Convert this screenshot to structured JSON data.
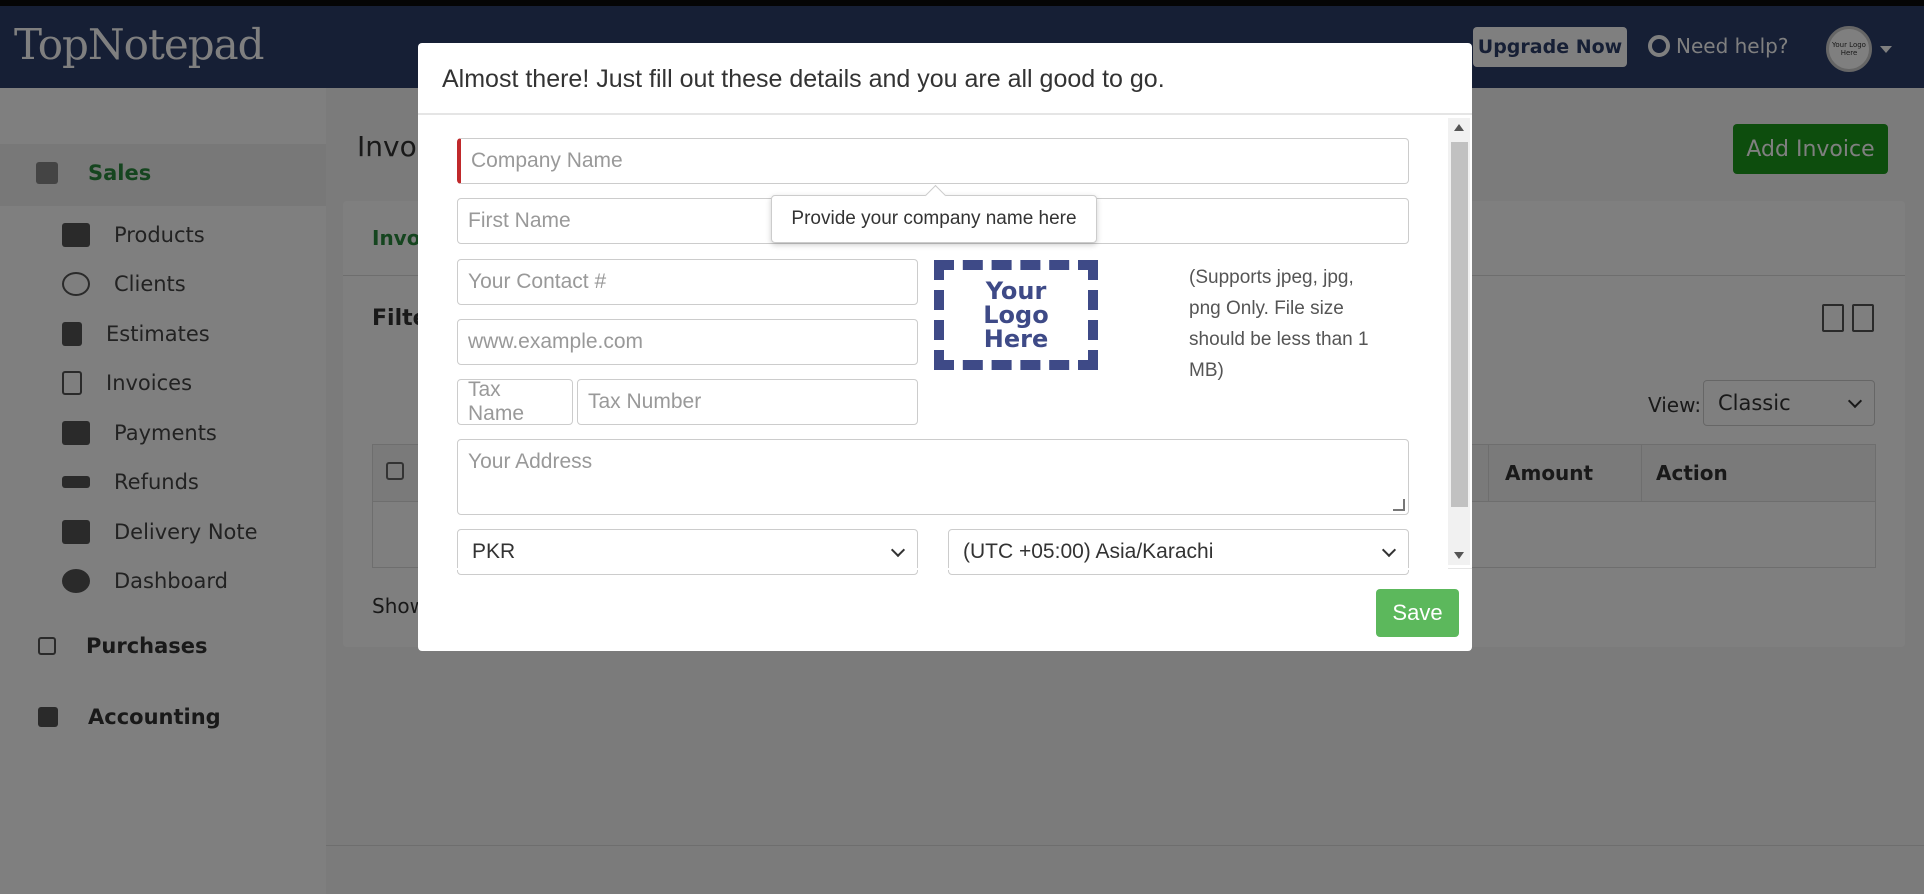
{
  "header": {
    "brand": "TopNotepad",
    "upgrade_label": "Upgrade Now",
    "help_label": "Need help?",
    "avatar_text": "Your Logo Here"
  },
  "sidebar": {
    "sales": "Sales",
    "items": [
      {
        "label": "Products",
        "icon": "boxes-icon"
      },
      {
        "label": "Clients",
        "icon": "user-icon"
      },
      {
        "label": "Estimates",
        "icon": "file-icon"
      },
      {
        "label": "Invoices",
        "icon": "file-outline-icon"
      },
      {
        "label": "Payments",
        "icon": "credit-card-icon"
      },
      {
        "label": "Refunds",
        "icon": "exchange-icon"
      },
      {
        "label": "Delivery Note",
        "icon": "truck-icon"
      },
      {
        "label": "Dashboard",
        "icon": "gauge-icon"
      }
    ],
    "purchases": "Purchases",
    "accounting": "Accounting"
  },
  "page": {
    "title": "Invoi",
    "add_button": "Add Invoice",
    "tab": "Invo",
    "filter": "Filte",
    "view_label": "View:",
    "view_value": "Classic",
    "col_amount": "Amount",
    "col_action": "Action",
    "showing": "Show"
  },
  "modal": {
    "title": "Almost there! Just fill out these details and you are all good to go.",
    "company_placeholder": "Company Name",
    "first_name_placeholder": "First Name",
    "contact_placeholder": "Your Contact #",
    "website_placeholder": "www.example.com",
    "tax_name_placeholder": "Tax Name",
    "tax_number_placeholder": "Tax Number",
    "address_placeholder": "Your Address",
    "currency": "PKR",
    "timezone": "(UTC +05:00) Asia/Karachi",
    "tooltip": "Provide your company name here",
    "logo_text_1": "Your",
    "logo_text_2": "Logo",
    "logo_text_3": "Here",
    "supports": "(Supports jpeg, jpg, png Only. File size should be less than 1 MB)",
    "save": "Save"
  }
}
